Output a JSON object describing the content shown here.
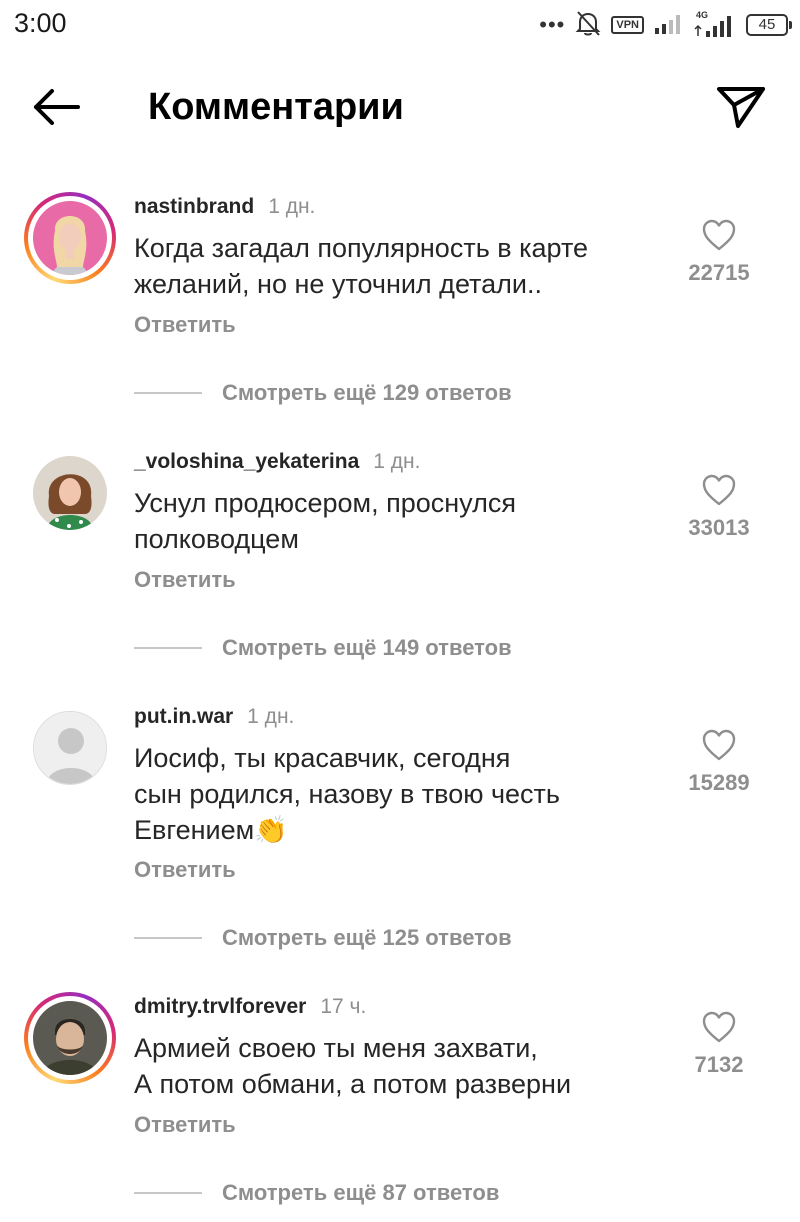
{
  "status_bar": {
    "time": "3:00",
    "vpn_label": "VPN",
    "network_label": "4G",
    "battery": "45",
    "icons": [
      "dots-icon",
      "bell-muted-icon",
      "vpn-icon",
      "signal-icon",
      "signal-4g-icon",
      "battery-icon"
    ]
  },
  "header": {
    "title": "Комментарии",
    "back_icon": "arrow-left-icon",
    "share_icon": "paper-plane-icon"
  },
  "reply_label": "Ответить",
  "comments": [
    {
      "username": "nastinbrand",
      "time": "1 дн.",
      "text": "Когда загадал популярность в карте\nжеланий, но не уточнил детали..",
      "likes": "22715",
      "view_replies": "Смотреть ещё 129 ответов",
      "story_ring": true
    },
    {
      "username": "_voloshina_yekaterina",
      "time": "1 дн.",
      "text": "Уснул продюсером, проснулся\nполководцем",
      "likes": "33013",
      "view_replies": "Смотреть ещё 149 ответов",
      "story_ring": false
    },
    {
      "username": "put.in.war",
      "time": "1 дн.",
      "text": "Иосиф, ты красавчик, сегодня\nсын родился, назову в твою честь\nЕвгением",
      "emoji": "👏",
      "likes": "15289",
      "view_replies": "Смотреть ещё 125 ответов",
      "story_ring": false
    },
    {
      "username": "dmitry.trvlforever",
      "time": "17 ч.",
      "text": "Армией своею ты меня захвати,\nА потом обмани, а потом разверни",
      "likes": "7132",
      "view_replies": "Смотреть ещё 87 ответов",
      "story_ring": true
    }
  ],
  "colors": {
    "text": "#262626",
    "secondary": "#8e8e8e",
    "ring_gradient": [
      "#feda75",
      "#fa7e1e",
      "#d62976",
      "#962fbf"
    ]
  }
}
